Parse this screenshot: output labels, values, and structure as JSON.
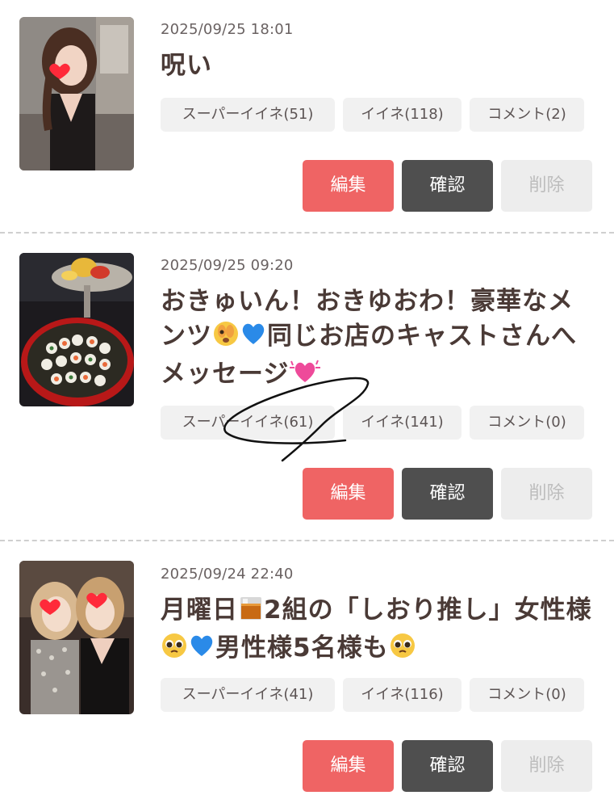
{
  "posts": [
    {
      "date": "2025/09/25 18:01",
      "title": "呪い",
      "tags": {
        "super_iine": "スーパーイイネ(51)",
        "iine": "イイネ(118)",
        "comment": "コメント(2)"
      },
      "actions": {
        "edit": "編集",
        "confirm": "確認",
        "delete": "削除"
      }
    },
    {
      "date": "2025/09/25 09:20",
      "title_parts": [
        "おきゅいん！おきゆおわ！豪華なメンツ",
        "同じお店のキャストさんへメッセージ"
      ],
      "tags": {
        "super_iine": "スーパーイイネ(61)",
        "iine": "イイネ(141)",
        "comment": "コメント(0)"
      },
      "actions": {
        "edit": "編集",
        "confirm": "確認",
        "delete": "削除"
      }
    },
    {
      "date": "2025/09/24 22:40",
      "title_parts": [
        "月曜日",
        "2組の「しおり推し」女性様",
        "男性様5名様も"
      ],
      "tags": {
        "super_iine": "スーパーイイネ(41)",
        "iine": "イイネ(116)",
        "comment": "コメント(0)"
      },
      "actions": {
        "edit": "編集",
        "confirm": "確認",
        "delete": "削除"
      }
    }
  ],
  "icons": [
    "peeking-face-emoji",
    "blue-heart-emoji",
    "sparkling-heart-emoji",
    "whisky-glass-emoji",
    "pleading-face-emoji",
    "heart-sticker"
  ],
  "colors": {
    "edit": "#ef6464",
    "confirm": "#4f4f4f",
    "delete": "#ededed",
    "tag_bg": "#f1f1f1"
  }
}
